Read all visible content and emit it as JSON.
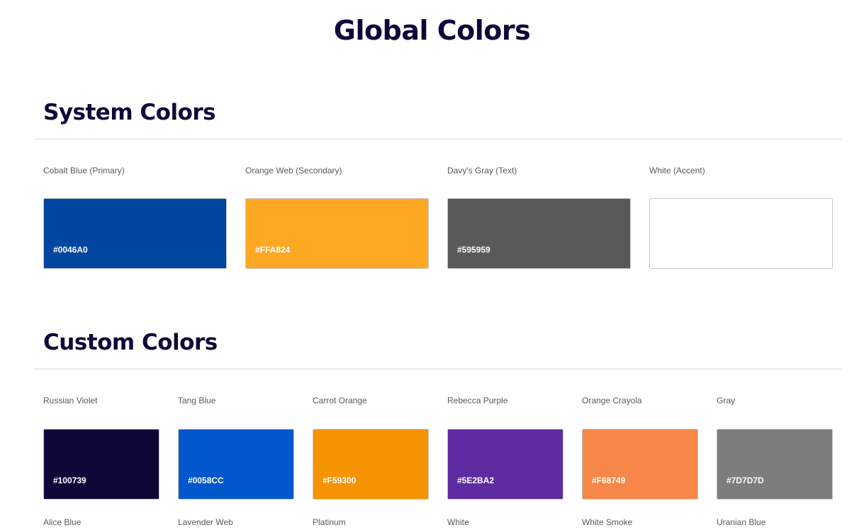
{
  "page_title": "Global Colors",
  "system": {
    "title": "System Colors",
    "colors": [
      {
        "name": "Cobalt Blue (Primary)",
        "hex": "#0046A0",
        "color": "#0046A0",
        "hex_visible": true
      },
      {
        "name": "Orange Web (Secondary)",
        "hex": "#FFA824",
        "color": "#FFA824",
        "hex_visible": true
      },
      {
        "name": "Davy's Gray (Text)",
        "hex": "#595959",
        "color": "#595959",
        "hex_visible": true
      },
      {
        "name": "White (Accent)",
        "hex": "",
        "color": "#FFFFFF",
        "hex_visible": false
      }
    ]
  },
  "custom": {
    "title": "Custom Colors",
    "row1": [
      {
        "name": "Russian Violet",
        "hex": "#100739",
        "color": "#100739"
      },
      {
        "name": "Tang Blue",
        "hex": "#0058CC",
        "color": "#0058CC"
      },
      {
        "name": "Carrot Orange",
        "hex": "#F59300",
        "color": "#F59300"
      },
      {
        "name": "Rebecca Purple",
        "hex": "#5E2BA2",
        "color": "#5E2BA2"
      },
      {
        "name": "Orange Crayola",
        "hex": "#F68749",
        "color": "#F68749"
      },
      {
        "name": "Gray",
        "hex": "#7D7D7D",
        "color": "#7D7D7D"
      }
    ],
    "row2": [
      {
        "name": "Alice Blue"
      },
      {
        "name": "Lavender Web"
      },
      {
        "name": "Platinum"
      },
      {
        "name": "White"
      },
      {
        "name": "White Smoke"
      },
      {
        "name": "Uranian Blue"
      }
    ]
  }
}
